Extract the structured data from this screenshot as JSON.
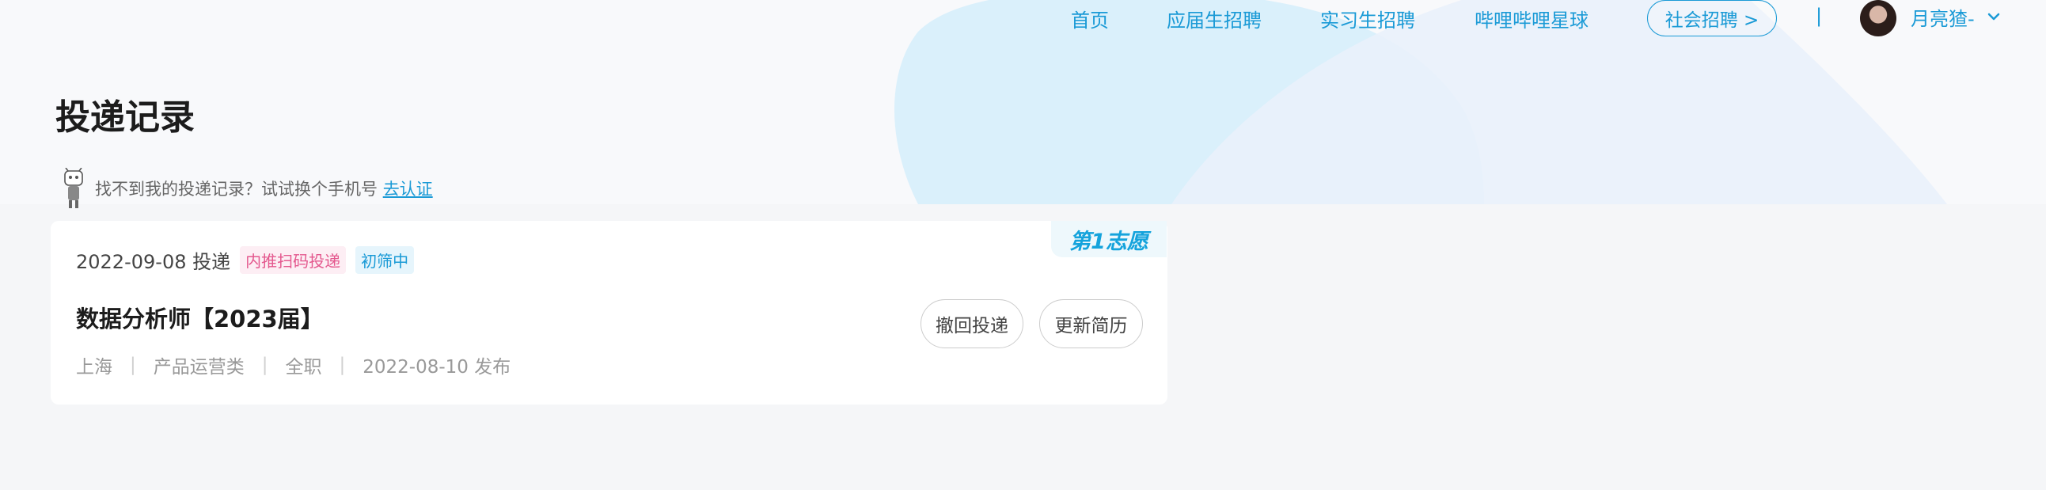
{
  "nav": {
    "home": "首页",
    "campus": "应届生招聘",
    "intern": "实习生招聘",
    "planet": "哔哩哔哩星球",
    "social": "社会招聘 >",
    "separator": "|",
    "username": "月亮猹-"
  },
  "page": {
    "title": "投递记录",
    "hint_text": "找不到我的投递记录？试试换个手机号",
    "hint_link": "去认证"
  },
  "application": {
    "ribbon": "第1志愿",
    "date_text": "2022-09-08 投递",
    "tags": [
      "内推扫码投递",
      "初筛中"
    ],
    "job_title": "数据分析师【2023届】",
    "city": "上海",
    "category": "产品运营类",
    "type": "全职",
    "publish_text": "2022-08-10 发布",
    "withdraw_label": "撤回投递",
    "update_label": "更新简历"
  },
  "colors": {
    "accent": "#1a9ad6",
    "tag_pink": "#e4588e",
    "background": "#f5f6f8"
  },
  "icons": [
    "chevron-down-icon",
    "mascot-icon"
  ]
}
